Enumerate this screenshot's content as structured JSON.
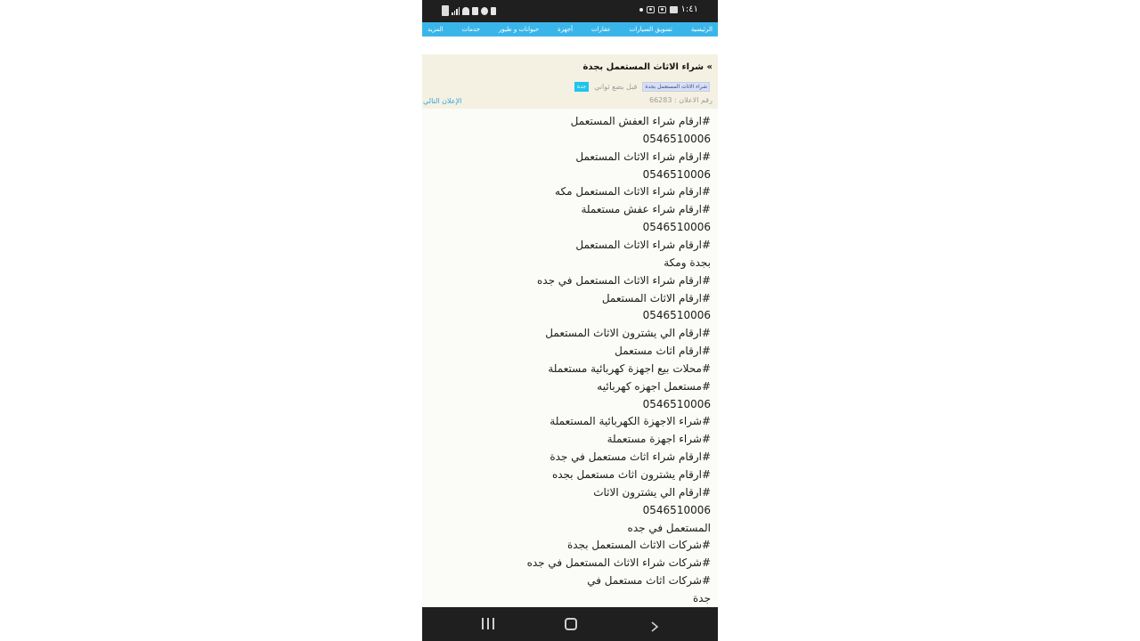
{
  "status_bar": {
    "time": "١:٤١"
  },
  "nav": {
    "items": [
      "الرئيسية",
      "تسويق السيارات",
      "عقارات",
      "أجهزة",
      "حيوانات و طيور",
      "خدمات",
      "المزيد"
    ]
  },
  "ad": {
    "title": "» شراء الاثاث المستعمل بجدة",
    "category_tag": "شراء الاثاث المستعمل بجدة",
    "time_ago": "قبل بضع ثواني",
    "city": "جدة",
    "ad_number_label": "رقم الاعلان : 66283",
    "next_ad_label": "الإعلان التالي"
  },
  "body_lines": [
    "#ارقام شراء العفش المستعمل",
    "0546510006",
    "#ارقام شراء الاثاث المستعمل",
    "0546510006",
    "#ارقام شراء الاثاث المستعمل مكه",
    "#ارقام شراء عفش مستعملة",
    "0546510006",
    "#ارقام شراء الاثاث المستعمل",
    "بجدة ومكة",
    "#ارقام شراء الاثاث المستعمل في جده",
    "#ارقام الاثاث المستعمل",
    "0546510006",
    "#ارقام الي يشترون الاثاث المستعمل",
    "#ارقام اثاث مستعمل",
    "#محلات بيع اجهزة كهربائية مستعملة",
    "#مستعمل اجهزه كهربائيه",
    "0546510006",
    "#شراء الاجهزة الكهربائية المستعملة",
    "#شراء اجهزة مستعملة",
    "#ارقام شراء اثاث مستعمل في جدة",
    "#ارقام يشترون اثاث مستعمل بجده",
    "#ارقام الي يشترون الاثاث",
    "0546510006",
    "المستعمل في جده",
    "#شركات الاثاث المستعمل بجدة",
    "#شركات شراء الاثاث المستعمل في جده",
    "#شركات اثاث مستعمل في",
    "جدة"
  ]
}
